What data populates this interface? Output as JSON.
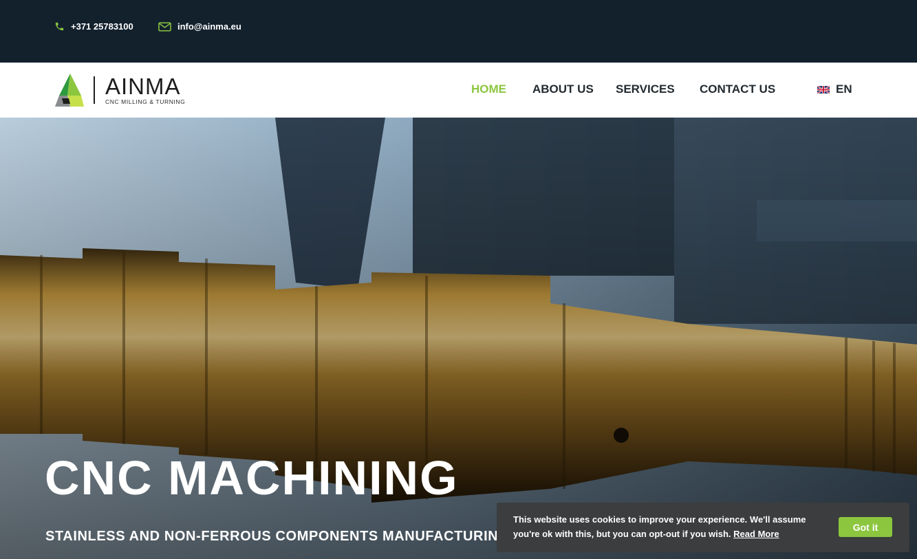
{
  "topbar": {
    "phone": "+371 25783100",
    "email": "info@ainma.eu",
    "phone_icon": "phone-icon",
    "email_icon": "envelope-icon"
  },
  "logo": {
    "name": "AINMA",
    "tagline": "CNC MILLING & TURNING"
  },
  "nav": {
    "items": [
      {
        "label": "HOME",
        "active": true
      },
      {
        "label": "ABOUT US",
        "active": false
      },
      {
        "label": "SERVICES",
        "active": false
      },
      {
        "label": "CONTACT US",
        "active": false
      }
    ],
    "language": "EN",
    "language_icon": "uk-flag-icon"
  },
  "hero": {
    "title": "CNC MACHINING",
    "subtitle": "STAINLESS AND NON-FERROUS COMPONENTS MANUFACTURING"
  },
  "cookie": {
    "text": "This website uses cookies to improve your experience. We'll assume you're ok with this, but you can opt-out if you wish.",
    "link": "Read More",
    "button": "Got it"
  },
  "colors": {
    "accent": "#8cc63f",
    "topbar_bg": "#13212d",
    "nav_text": "#222a30",
    "cookie_bg": "#3b3d3e"
  }
}
